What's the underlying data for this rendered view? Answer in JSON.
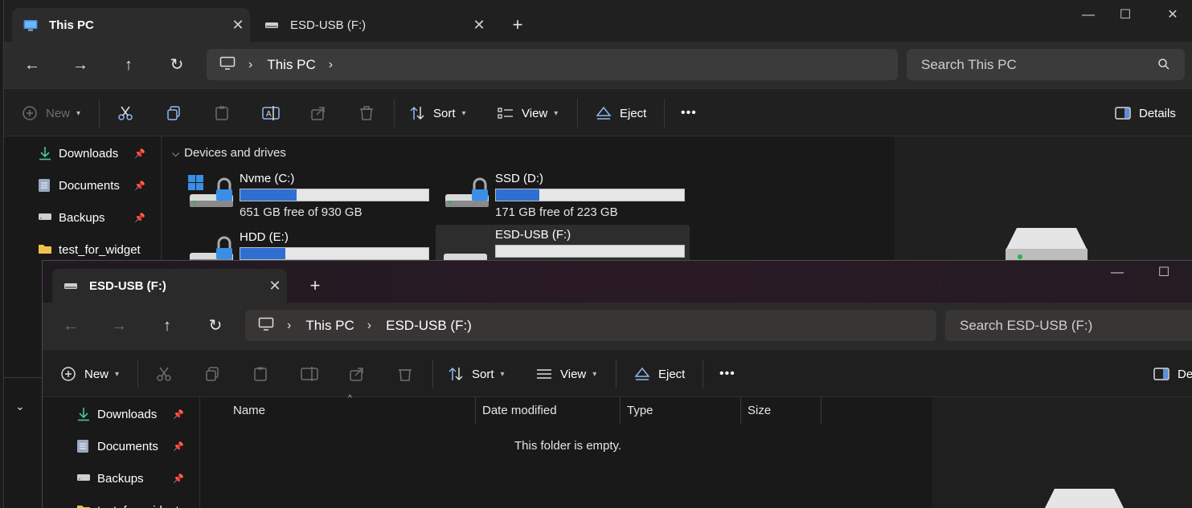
{
  "back_window": {
    "tabs": [
      {
        "label": "This PC",
        "close": "✕"
      },
      {
        "label": "ESD-USB (F:)",
        "close": "✕"
      }
    ],
    "new_tab": "+",
    "controls": {
      "minimize": "—",
      "maximize": "☐",
      "close": "✕"
    },
    "breadcrumb": [
      "This PC"
    ],
    "search_placeholder": "Search This PC",
    "commands": {
      "new": "New",
      "sort": "Sort",
      "view": "View",
      "eject": "Eject",
      "more": "•••",
      "details": "Details"
    },
    "sidebar": [
      {
        "label": "Downloads",
        "pinned": true
      },
      {
        "label": "Documents",
        "pinned": true
      },
      {
        "label": "Backups",
        "pinned": true
      },
      {
        "label": "test_for_widget",
        "pinned": false
      }
    ],
    "group_title": "Devices and drives",
    "drives": [
      {
        "name": "Nvme (C:)",
        "free": "651 GB free of 930 GB",
        "used_fraction": 0.3
      },
      {
        "name": "SSD (D:)",
        "free": "171 GB free of 223 GB",
        "used_fraction": 0.23
      },
      {
        "name": "HDD (E:)",
        "free": "",
        "used_fraction": 0.24
      },
      {
        "name": "ESD-USB (F:)",
        "free": "",
        "used_fraction": 0.0
      }
    ]
  },
  "front_window": {
    "tabs": [
      {
        "label": "ESD-USB (F:)",
        "close": "✕"
      }
    ],
    "new_tab": "+",
    "controls": {
      "minimize": "—",
      "maximize": "☐"
    },
    "breadcrumb": [
      "This PC",
      "ESD-USB (F:)"
    ],
    "search_placeholder": "Search ESD-USB (F:)",
    "commands": {
      "new": "New",
      "sort": "Sort",
      "view": "View",
      "eject": "Eject",
      "more": "•••",
      "details": "De"
    },
    "sidebar": [
      {
        "label": "Downloads",
        "pinned": true
      },
      {
        "label": "Documents",
        "pinned": true
      },
      {
        "label": "Backups",
        "pinned": true
      },
      {
        "label": "test_for_widget",
        "pinned": false
      }
    ],
    "columns": [
      "Name",
      "Date modified",
      "Type",
      "Size"
    ],
    "empty_message": "This folder is empty."
  },
  "colors": {
    "accent": "#2f6fd1",
    "pin": "#bbbbbb"
  }
}
